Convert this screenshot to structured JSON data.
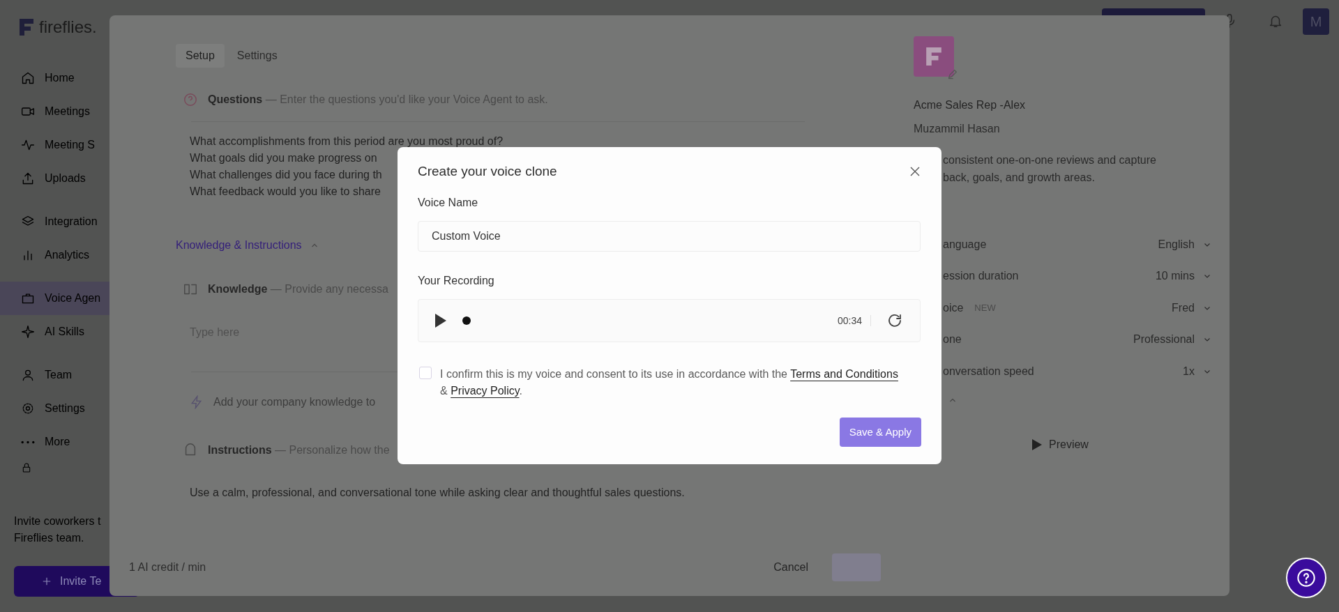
{
  "sidebar": {
    "logo": "fireflies.",
    "groups": [
      [
        {
          "label": "Home",
          "selected": false
        },
        {
          "label": "Meetings",
          "selected": false
        },
        {
          "label": "Meeting S",
          "selected": false
        },
        {
          "label": "Uploads",
          "selected": false
        }
      ],
      [
        {
          "label": "Integration",
          "selected": false
        },
        {
          "label": "Analytics",
          "selected": false
        }
      ],
      [
        {
          "label": "Voice Agen",
          "selected": true
        },
        {
          "label": "AI Skills",
          "selected": false
        }
      ],
      [
        {
          "label": "Team",
          "selected": false
        },
        {
          "label": "Settings",
          "selected": false
        },
        {
          "label": "More",
          "selected": false
        }
      ]
    ],
    "invite_lines": [
      "Invite coworkers t",
      "Fireflies team."
    ],
    "invite_button": "Invite Te"
  },
  "topbar": {
    "avatar": "M"
  },
  "agent_modal": {
    "tabs": [
      {
        "label": "Setup",
        "selected": true
      },
      {
        "label": "Settings",
        "selected": false
      }
    ],
    "questions": {
      "title": "Questions",
      "hint": "— Enter the questions you'd like your Voice Agent to ask.",
      "lines": [
        "What accomplishments from this period are you most proud of?",
        "What goals did you make progress on",
        "What challenges did you face during th",
        "What feedback would you like to share"
      ]
    },
    "section_toggle": {
      "label": "Knowledge & Instructions",
      "expanded": true
    },
    "knowledge": {
      "title": "Knowledge",
      "hint": "— Provide any necessa",
      "placeholder": "Type here",
      "tip": "Add your company knowledge to"
    },
    "instructions": {
      "title": "Instructions",
      "hint": "— Personalize how the",
      "value": "Use a calm, professional, and conversational tone while asking clear and thoughtful sales questions."
    },
    "footer": {
      "credit": "1 AI credit / min",
      "cancel": "Cancel"
    },
    "agent": {
      "name": "Acme Sales Rep -Alex",
      "owner": "Muzammil Hasan",
      "description": [
        "consistent one-on-one reviews and capture",
        "back, goals, and growth areas."
      ]
    },
    "settings": [
      {
        "label": "anguage",
        "value": "English"
      },
      {
        "label": "ession duration",
        "value": "10 mins"
      },
      {
        "label": "oice",
        "badge": "NEW",
        "value": "Fred"
      },
      {
        "label": "one",
        "value": "Professional"
      },
      {
        "label": "onversation speed",
        "value": "1x"
      }
    ],
    "preview": "Preview"
  },
  "dialog": {
    "title": "Create your voice clone",
    "name_label": "Voice Name",
    "name_value": "Custom Voice",
    "recording_label": "Your Recording",
    "duration": "00:34",
    "consent": {
      "checked": false,
      "text": "I confirm this is my voice and consent to its use in accordance with the",
      "terms": "Terms and Conditions",
      "amp": "&",
      "privacy": "Privacy Policy",
      "end": "."
    },
    "save": {
      "label": "Save & Apply",
      "disabled": true
    }
  }
}
